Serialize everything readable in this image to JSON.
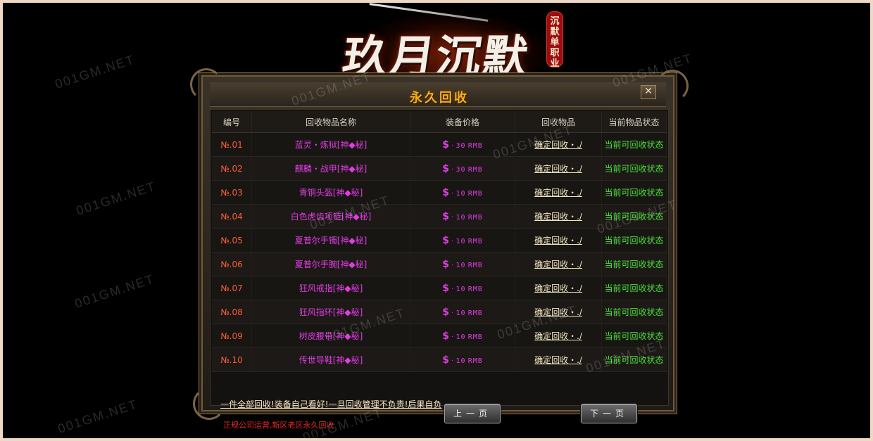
{
  "logo": {
    "title": "玖月沉默",
    "seal_line1": "沉默",
    "seal_line2": "单职",
    "seal_line3": "业"
  },
  "dialog": {
    "title": "永久回收",
    "close_icon": "✕"
  },
  "table": {
    "headers": [
      "编号",
      "回收物品名称",
      "装备价格",
      "回收物品",
      "当前物品状态"
    ],
    "rows": [
      {
        "num": "№.01",
        "name": "蓝灵・炼狱[神◆秘]",
        "price": "30",
        "currency": "RMB",
        "action": "确定回收・./",
        "status": "当前可回收状态"
      },
      {
        "num": "№.02",
        "name": "麒麟・战甲[神◆秘]",
        "price": "30",
        "currency": "RMB",
        "action": "确定回收・./",
        "status": "当前可回收状态"
      },
      {
        "num": "№.03",
        "name": "青铜头盔[神◆秘]",
        "price": "10",
        "currency": "RMB",
        "action": "确定回收・./",
        "status": "当前可回收状态"
      },
      {
        "num": "№.04",
        "name": "白色虎齿项链[神◆秘]",
        "price": "10",
        "currency": "RMB",
        "action": "确定回收・./",
        "status": "当前可回收状态"
      },
      {
        "num": "№.05",
        "name": "夏普尔手镯[神◆秘]",
        "price": "10",
        "currency": "RMB",
        "action": "确定回收・./",
        "status": "当前可回收状态"
      },
      {
        "num": "№.06",
        "name": "夏普尔手腕[神◆秘]",
        "price": "10",
        "currency": "RMB",
        "action": "确定回收・./",
        "status": "当前可回收状态"
      },
      {
        "num": "№.07",
        "name": "狂风戒指[神◆秘]",
        "price": "10",
        "currency": "RMB",
        "action": "确定回收・./",
        "status": "当前可回收状态"
      },
      {
        "num": "№.08",
        "name": "狂风指环[神◆秘]",
        "price": "10",
        "currency": "RMB",
        "action": "确定回收・./",
        "status": "当前可回收状态"
      },
      {
        "num": "№.09",
        "name": "树皮腰带[神◆秘]",
        "price": "10",
        "currency": "RMB",
        "action": "确定回收・./",
        "status": "当前可回收状态"
      },
      {
        "num": "№.10",
        "name": "传世导鞋[神◆秘]",
        "price": "10",
        "currency": "RMB",
        "action": "确定回收・./",
        "status": "当前可回收状态"
      }
    ],
    "price_symbol": "$",
    "price_sep": "·"
  },
  "footer": {
    "recycle_all_link": "一件全部回收!装备自己看好!一旦回收管理不负责!后果自负",
    "notice": "正规公司运营,新区老区永久回收",
    "prev_button": "上一页",
    "next_button": "下一页"
  },
  "watermark": "001GM.NET",
  "colors": {
    "title_gold": "#f0b21e",
    "item_magenta": "#e23ce4",
    "number_red": "#ff5a3a",
    "status_green": "#4ee03c",
    "notice_red": "#e52a2a"
  }
}
